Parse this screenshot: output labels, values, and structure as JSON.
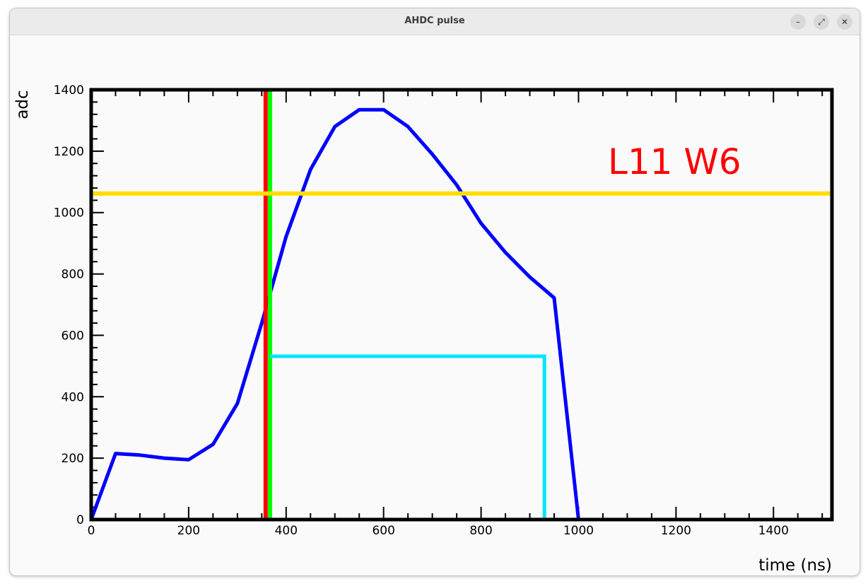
{
  "window": {
    "title": "AHDC pulse",
    "controls": {
      "minimize": "–",
      "maximize": "⤢",
      "close": "✕"
    }
  },
  "chart_data": {
    "type": "line",
    "xlabel": "time (ns)",
    "ylabel": "adc",
    "xlim": [
      0,
      1520
    ],
    "ylim": [
      0,
      1400
    ],
    "x_ticks": [
      0,
      200,
      400,
      600,
      800,
      1000,
      1200,
      1400
    ],
    "y_ticks": [
      0,
      200,
      400,
      600,
      800,
      1000,
      1200,
      1400
    ],
    "annotation": "L11 W6",
    "grid": false,
    "series": [
      {
        "color": "#0000ff",
        "x": [
          0,
          50,
          100,
          150,
          200,
          250,
          300,
          350,
          400,
          450,
          500,
          550,
          600,
          650,
          700,
          750,
          800,
          850,
          900,
          950,
          1000,
          1050,
          1100,
          1150,
          1200,
          1250,
          1300,
          1350,
          1400,
          1450
        ],
        "y": [
          0,
          215,
          210,
          200,
          195,
          245,
          378,
          640,
          922,
          1140,
          1280,
          1335,
          1335,
          1280,
          1190,
          1090,
          965,
          870,
          790,
          722,
          0,
          0,
          0,
          0,
          0,
          0,
          0,
          0,
          0,
          0
        ]
      }
    ],
    "markers": [
      {
        "type": "vline",
        "color": "#ff0000",
        "x": 358
      },
      {
        "type": "vline",
        "color": "#00ff00",
        "x": 367
      },
      {
        "type": "hline",
        "color": "#ffdd00",
        "y": 1062
      },
      {
        "type": "width_box",
        "color": "#00e5ff",
        "x_start": 367,
        "x_end": 930,
        "y": 532
      }
    ]
  }
}
